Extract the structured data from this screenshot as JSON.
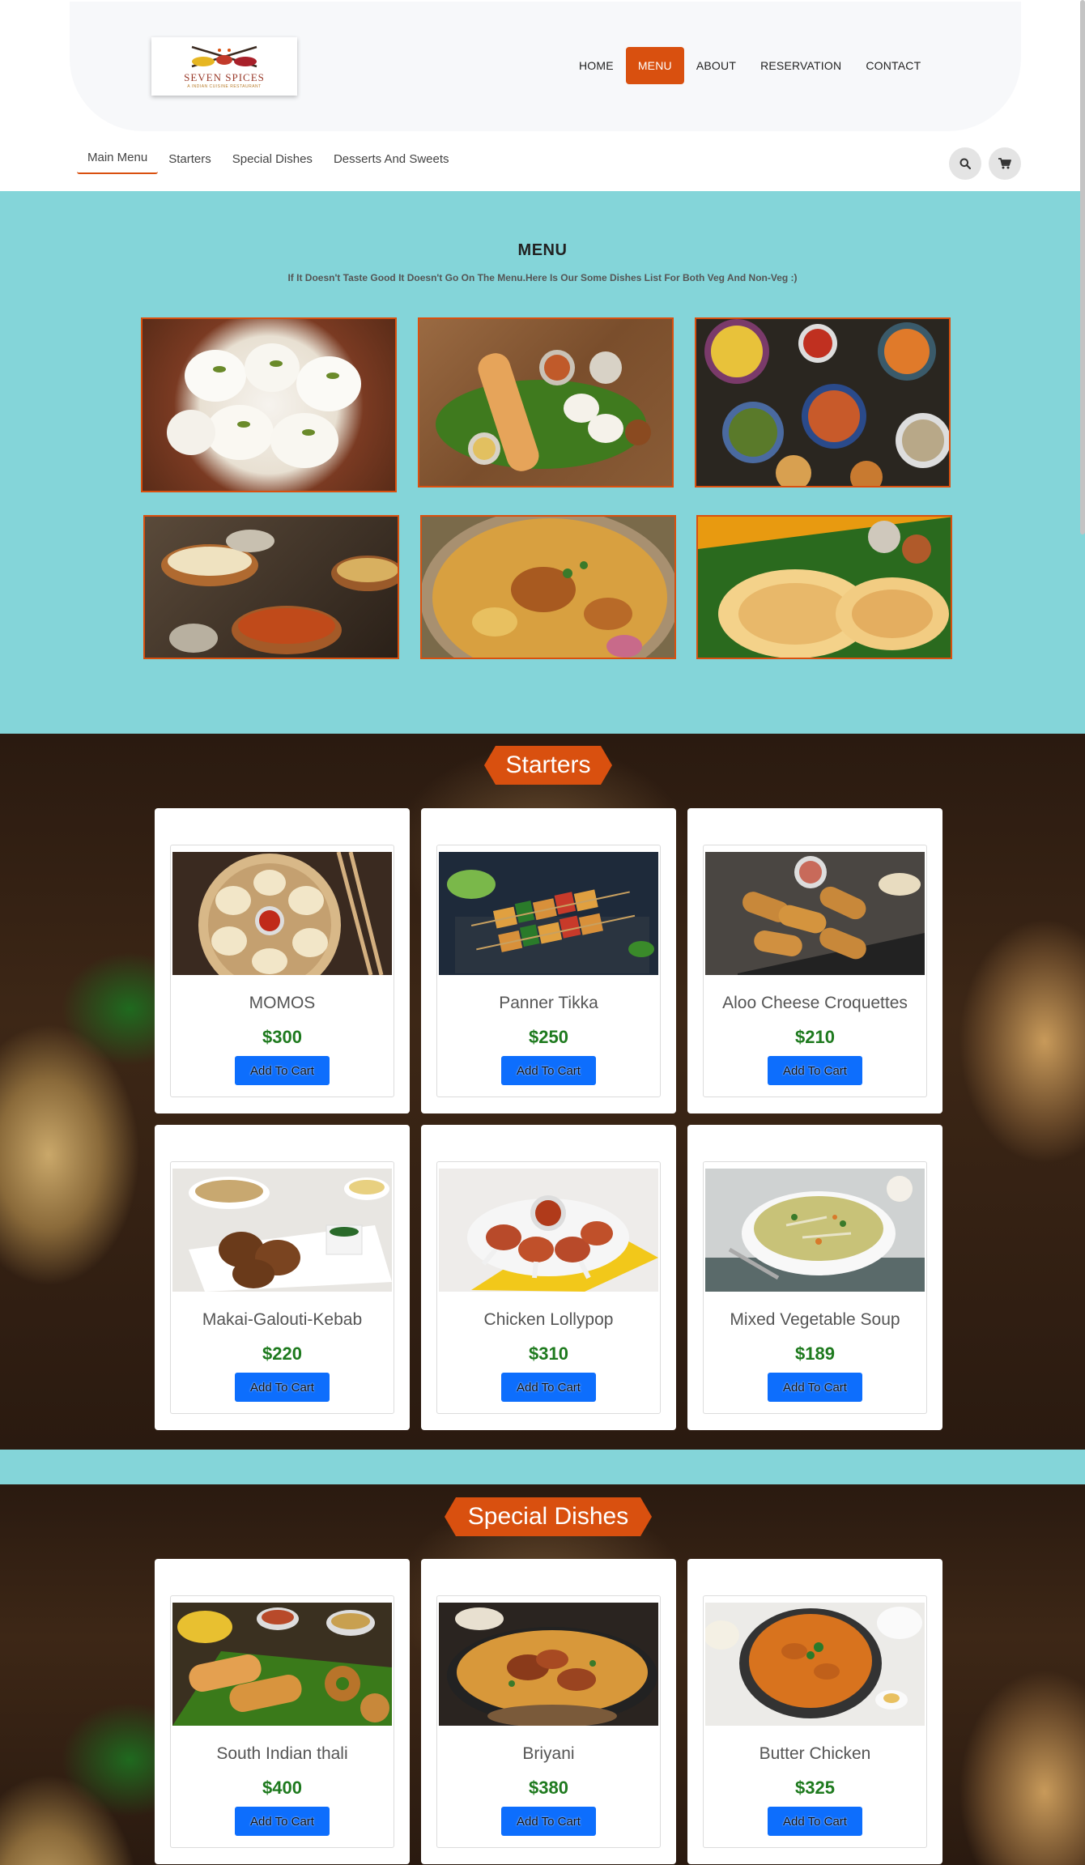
{
  "brand": {
    "name": "SEVEN SPICES",
    "tagline": "A INDIAN CUISINE RESTAURANT"
  },
  "topnav": [
    {
      "label": "HOME",
      "active": false
    },
    {
      "label": "MENU",
      "active": true
    },
    {
      "label": "ABOUT",
      "active": false
    },
    {
      "label": "RESERVATION",
      "active": false
    },
    {
      "label": "CONTACT",
      "active": false
    }
  ],
  "subnav": [
    {
      "label": "Main Menu",
      "active": true
    },
    {
      "label": "Starters",
      "active": false
    },
    {
      "label": "Special Dishes",
      "active": false
    },
    {
      "label": "Desserts And Sweets",
      "active": false
    }
  ],
  "icons": {
    "search": "search-icon",
    "cart": "cart-icon"
  },
  "menu": {
    "title": "MENU",
    "subtitle": "If It Doesn't Taste Good It Doesn't Go On The Menu.Here Is Our Some Dishes List For Both Veg And Non-Veg :)"
  },
  "starters": {
    "heading": "Starters",
    "items": [
      {
        "name": "MOMOS",
        "price": "$300",
        "button": "Add To Cart"
      },
      {
        "name": "Panner Tikka",
        "price": "$250",
        "button": "Add To Cart"
      },
      {
        "name": "Aloo Cheese Croquettes",
        "price": "$210",
        "button": "Add To Cart"
      },
      {
        "name": "Makai-Galouti-Kebab",
        "price": "$220",
        "button": "Add To Cart"
      },
      {
        "name": "Chicken Lollypop",
        "price": "$310",
        "button": "Add To Cart"
      },
      {
        "name": "Mixed Vegetable Soup",
        "price": "$189",
        "button": "Add To Cart"
      }
    ]
  },
  "special": {
    "heading": "Special Dishes",
    "items": [
      {
        "name": "South Indian thali",
        "price": "$400",
        "button": "Add To Cart"
      },
      {
        "name": "Briyani",
        "price": "$380",
        "button": "Add To Cart"
      },
      {
        "name": "Butter Chicken",
        "price": "$325",
        "button": "Add To Cart"
      }
    ]
  },
  "colors": {
    "accent": "#d9500f",
    "teal": "#84d5d9",
    "price": "#1e7a1e",
    "button": "#0d6efd"
  }
}
